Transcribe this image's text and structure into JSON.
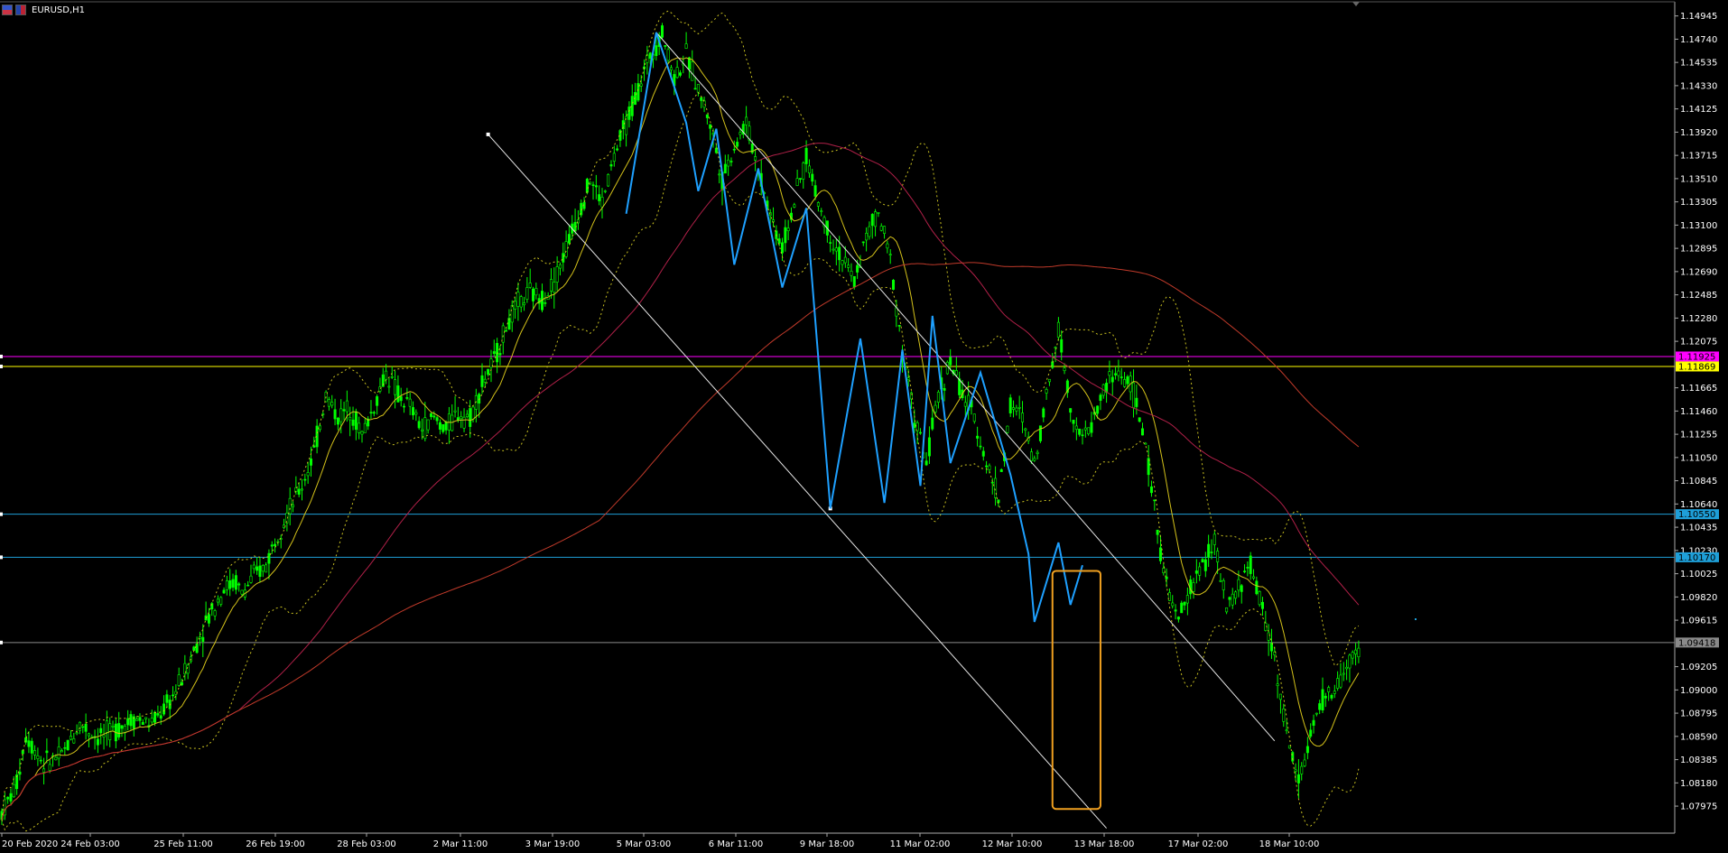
{
  "window": {
    "symbol_title": "EURUSD,H1",
    "icons": [
      "chart-window-icon",
      "currency-flag-icon"
    ]
  },
  "colors": {
    "background": "#000000",
    "candles": "#00ff00",
    "zigzag": "#1ea0ff",
    "ma_fast": "#d4c21a",
    "ma_slow": "#b02048",
    "ma_long": "#c03a2a",
    "bollinger": "#c8c020",
    "channel": "#e6e6e6",
    "level_magenta": "#ff00ff",
    "level_yellow": "#ffff00",
    "level_cyan": "#1e9fd8",
    "level_gray": "#8a8a8a",
    "box": "#f0a020",
    "axis_text": "#ffffff"
  },
  "chart_data": {
    "type": "candlestick",
    "symbol": "EURUSD",
    "timeframe": "H1",
    "ylim": [
      1.0788,
      1.1499
    ],
    "y_ticks": [
      "1.14945",
      "1.14740",
      "1.14535",
      "1.14330",
      "1.14125",
      "1.13920",
      "1.13715",
      "1.13510",
      "1.13305",
      "1.13100",
      "1.12895",
      "1.12690",
      "1.12485",
      "1.12280",
      "1.12075",
      "1.11665",
      "1.11460",
      "1.11255",
      "1.11050",
      "1.10845",
      "1.10640",
      "1.10435",
      "1.10230",
      "1.10025",
      "1.09820",
      "1.09615",
      "1.09205",
      "1.09000",
      "1.08795",
      "1.08590",
      "1.08385",
      "1.08180",
      "1.07975"
    ],
    "x_ticks": [
      "20 Feb 2020",
      "24 Feb 03:00",
      "25 Feb 11:00",
      "26 Feb 19:00",
      "28 Feb 03:00",
      "2 Mar 11:00",
      "3 Mar 19:00",
      "5 Mar 03:00",
      "6 Mar 11:00",
      "9 Mar 18:00",
      "11 Mar 02:00",
      "12 Mar 10:00",
      "13 Mar 18:00",
      "17 Mar 02:00",
      "18 Mar 10:00"
    ],
    "horizontal_levels": [
      {
        "price": "1.11925",
        "label": "1.11925",
        "color": "#ff00ff"
      },
      {
        "price": "1.11869",
        "label": "1.11869",
        "color": "#ffff00"
      },
      {
        "price": "1.10550",
        "label": "1.10550",
        "color": "#1e9fd8"
      },
      {
        "price": "1.10170",
        "label": "1.10170",
        "color": "#1e9fd8"
      },
      {
        "price": "1.09418",
        "label": "1.09418",
        "color": "#8a8a8a"
      }
    ],
    "price_path": [
      [
        0,
        1.0792
      ],
      [
        1.2,
        1.0815
      ],
      [
        2,
        1.086
      ],
      [
        3.5,
        1.0835
      ],
      [
        5,
        1.0842
      ],
      [
        6.5,
        1.087
      ],
      [
        8,
        1.0858
      ],
      [
        9.5,
        1.0865
      ],
      [
        11,
        1.0875
      ],
      [
        12.5,
        1.087
      ],
      [
        14,
        1.089
      ],
      [
        15,
        1.091
      ],
      [
        16,
        1.0935
      ],
      [
        17,
        1.096
      ],
      [
        18.5,
        1.099
      ],
      [
        19.5,
        1.0995
      ],
      [
        20,
        1.0985
      ],
      [
        21,
        1.1
      ],
      [
        22,
        1.101
      ],
      [
        23,
        1.104
      ],
      [
        24,
        1.106
      ],
      [
        25,
        1.108
      ],
      [
        26,
        1.111
      ],
      [
        27,
        1.116
      ],
      [
        28,
        1.114
      ],
      [
        29,
        1.115
      ],
      [
        30,
        1.1125
      ],
      [
        31,
        1.115
      ],
      [
        32,
        1.118
      ],
      [
        33,
        1.116
      ],
      [
        34,
        1.115
      ],
      [
        35,
        1.113
      ],
      [
        36,
        1.114
      ],
      [
        37,
        1.113
      ],
      [
        38,
        1.1145
      ],
      [
        39,
        1.114
      ],
      [
        40,
        1.117
      ],
      [
        41,
        1.119
      ],
      [
        42,
        1.122
      ],
      [
        43,
        1.124
      ],
      [
        44,
        1.125
      ],
      [
        45,
        1.1245
      ],
      [
        46,
        1.126
      ],
      [
        47,
        1.129
      ],
      [
        48,
        1.132
      ],
      [
        49,
        1.135
      ],
      [
        50,
        1.133
      ],
      [
        51,
        1.137
      ],
      [
        52,
        1.14
      ],
      [
        53,
        1.143
      ],
      [
        54,
        1.146
      ],
      [
        55,
        1.148
      ],
      [
        56,
        1.144
      ],
      [
        57,
        1.146
      ],
      [
        58,
        1.143
      ],
      [
        59,
        1.14
      ],
      [
        60,
        1.135
      ],
      [
        61,
        1.138
      ],
      [
        62,
        1.14
      ],
      [
        63,
        1.136
      ],
      [
        64,
        1.132
      ],
      [
        65,
        1.129
      ],
      [
        66,
        1.133
      ],
      [
        67,
        1.137
      ],
      [
        68,
        1.133
      ],
      [
        69,
        1.13
      ],
      [
        70,
        1.128
      ],
      [
        71,
        1.126
      ],
      [
        72,
        1.13
      ],
      [
        73,
        1.132
      ],
      [
        74,
        1.128
      ],
      [
        75,
        1.12
      ],
      [
        76,
        1.114
      ],
      [
        77,
        1.11
      ],
      [
        78,
        1.116
      ],
      [
        79,
        1.119
      ],
      [
        80,
        1.116
      ],
      [
        81,
        1.114
      ],
      [
        82,
        1.11
      ],
      [
        83,
        1.107
      ],
      [
        84,
        1.115
      ],
      [
        85,
        1.114
      ],
      [
        86,
        1.11
      ],
      [
        87,
        1.116
      ],
      [
        88,
        1.122
      ],
      [
        89,
        1.115
      ],
      [
        90,
        1.112
      ],
      [
        91,
        1.114
      ],
      [
        92,
        1.117
      ],
      [
        93,
        1.118
      ],
      [
        94,
        1.117
      ],
      [
        95,
        1.113
      ],
      [
        96,
        1.106
      ],
      [
        97,
        1.099
      ],
      [
        98,
        1.096
      ],
      [
        99,
        1.099
      ],
      [
        100,
        1.101
      ],
      [
        101,
        1.103
      ],
      [
        102,
        1.097
      ],
      [
        103,
        1.099
      ],
      [
        104,
        1.101
      ],
      [
        105,
        1.097
      ],
      [
        106,
        1.093
      ],
      [
        107,
        1.086
      ],
      [
        108,
        1.082
      ],
      [
        109,
        1.086
      ],
      [
        110,
        1.089
      ],
      [
        111,
        1.09
      ],
      [
        112,
        1.092
      ],
      [
        113,
        1.0935
      ]
    ],
    "zigzag_points": [
      [
        52,
        1.132
      ],
      [
        54.5,
        1.148
      ],
      [
        57,
        1.14
      ],
      [
        58,
        1.134
      ],
      [
        59.5,
        1.1395
      ],
      [
        61,
        1.1275
      ],
      [
        63,
        1.136
      ],
      [
        65,
        1.1255
      ],
      [
        67,
        1.1325
      ],
      [
        69,
        1.106
      ],
      [
        71.5,
        1.121
      ],
      [
        73.5,
        1.1065
      ],
      [
        75,
        1.12
      ],
      [
        76.5,
        1.108
      ],
      [
        77.5,
        1.123
      ],
      [
        79,
        1.11
      ],
      [
        81.5,
        1.118
      ],
      [
        84,
        1.109
      ],
      [
        85.5,
        1.102
      ],
      [
        86,
        1.096
      ],
      [
        88,
        1.103
      ],
      [
        89,
        1.0975
      ],
      [
        90,
        1.101
      ]
    ],
    "box_annotation": {
      "x_from": 87.5,
      "x_to": 91.5,
      "y_from": 1.0795,
      "y_to": 1.1005,
      "color": "#f0a020"
    },
    "channel_lines": [
      {
        "from": [
          40.5,
          1.139
        ],
        "to": [
          92,
          1.0778
        ]
      },
      {
        "from": [
          54.5,
          1.148
        ],
        "to": [
          106,
          1.0855
        ]
      }
    ],
    "grid": false,
    "legend": "none"
  }
}
